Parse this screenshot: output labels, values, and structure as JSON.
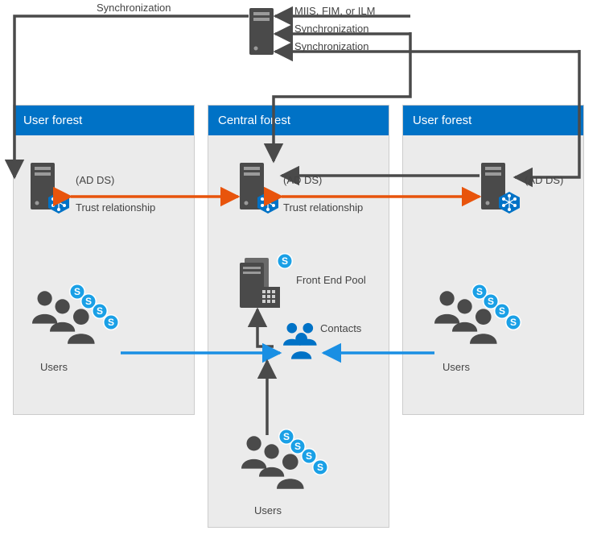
{
  "sync_server": {
    "label": "MIIS, FIM, or ILM",
    "line_left": "Synchronization",
    "line_right1": "Synchronization",
    "line_right2": "Synchronization"
  },
  "forests": {
    "left": {
      "title": "User forest",
      "adds": "(AD DS)",
      "trust": "Trust relationship",
      "users_label": "Users"
    },
    "center": {
      "title": "Central forest",
      "adds": "(AD DS)",
      "trust": "Trust relationship",
      "users_label": "Users",
      "frontend_label": "Front End Pool",
      "contacts_label": "Contacts"
    },
    "right": {
      "title": "User forest",
      "adds": "(AD DS)",
      "users_label": "Users"
    }
  },
  "colors": {
    "ms_blue": "#0072c6",
    "dark": "#4a4a4a",
    "orange": "#e8540c",
    "bright_blue": "#1a8fe3",
    "panel_bg": "#ebebeb"
  }
}
